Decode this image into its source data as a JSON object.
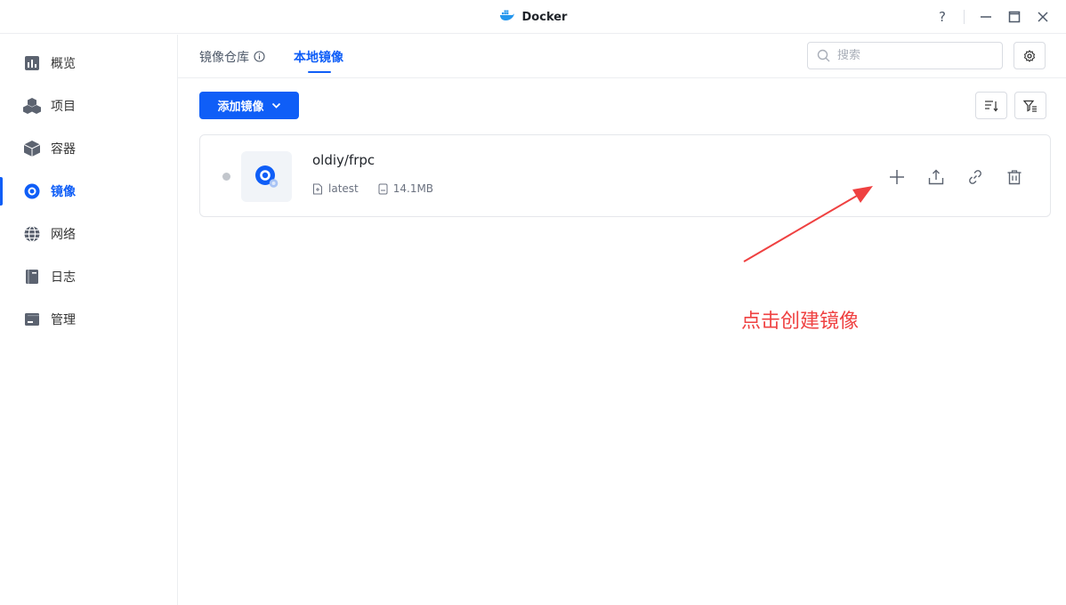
{
  "window": {
    "title": "Docker",
    "help_label": "?"
  },
  "sidebar": {
    "items": [
      {
        "label": "概览",
        "icon": "overview-icon"
      },
      {
        "label": "项目",
        "icon": "project-icon"
      },
      {
        "label": "容器",
        "icon": "container-icon"
      },
      {
        "label": "镜像",
        "icon": "image-icon",
        "active": true
      },
      {
        "label": "网络",
        "icon": "network-icon"
      },
      {
        "label": "日志",
        "icon": "log-icon"
      },
      {
        "label": "管理",
        "icon": "manage-icon"
      }
    ]
  },
  "tabs": [
    {
      "label": "镜像仓库",
      "active": false
    },
    {
      "label": "本地镜像",
      "active": true
    }
  ],
  "search": {
    "placeholder": "搜索"
  },
  "toolbar": {
    "add_label": "添加镜像"
  },
  "images": [
    {
      "name": "oldiy/frpc",
      "tag": "latest",
      "size": "14.1MB",
      "status": "stopped"
    }
  ],
  "annotation": {
    "text": "点击创建镜像",
    "color": "#ef4141"
  },
  "colors": {
    "accent": "#0f5ef7",
    "status_inactive": "#c2c6cc"
  }
}
